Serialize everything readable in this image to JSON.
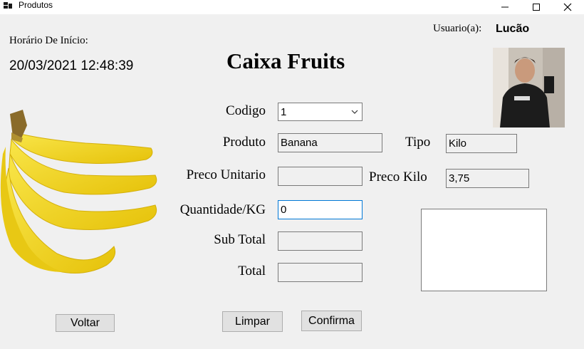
{
  "window": {
    "title": "Produtos"
  },
  "header": {
    "start_label": "Horário De Início:",
    "start_time": "20/03/2021 12:48:39",
    "user_label": "Usuario(a):",
    "user_name": "Lucão",
    "app_title": "Caixa Fruits"
  },
  "form": {
    "codigo_label": "Codigo",
    "codigo_value": "1",
    "produto_label": "Produto",
    "produto_value": "Banana",
    "tipo_label": "Tipo",
    "tipo_value": "Kilo",
    "preco_unitario_label": "Preco Unitario",
    "preco_unitario_value": "",
    "preco_kilo_label": "Preco Kilo",
    "preco_kilo_value": "3,75",
    "quantidade_label": "Quantidade/KG",
    "quantidade_value": "0",
    "subtotal_label": "Sub Total",
    "subtotal_value": "",
    "total_label": "Total",
    "total_value": ""
  },
  "buttons": {
    "voltar": "Voltar",
    "limpar": "Limpar",
    "confirma": "Confirma"
  },
  "colors": {
    "accent": "#0078d7",
    "background": "#f0f0f0"
  }
}
